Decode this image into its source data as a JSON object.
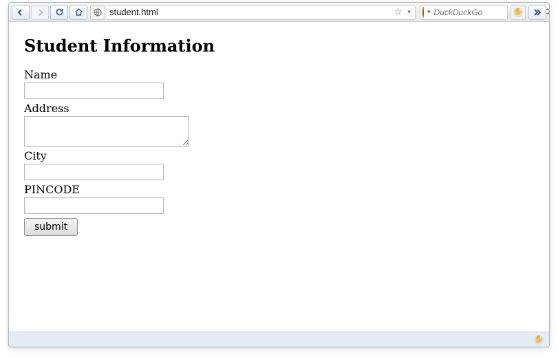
{
  "toolbar": {
    "url": "student.html",
    "search_placeholder": "DuckDuckGo"
  },
  "page": {
    "heading": "Student Information",
    "labels": {
      "name": "Name",
      "address": "Address",
      "city": "City",
      "pincode": "PINCODE"
    },
    "values": {
      "name": "",
      "address": "",
      "city": "",
      "pincode": ""
    },
    "submit_label": "submit"
  }
}
